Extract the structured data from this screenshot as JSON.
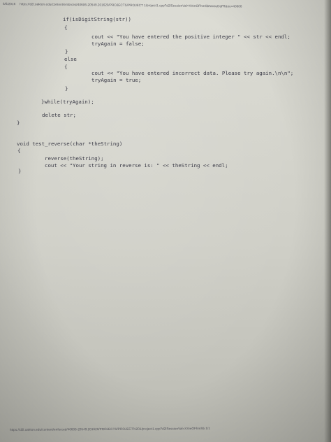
{
  "header": {
    "date": "6/6/2016",
    "url": "https://d2l.oakton.edu/content/enforced/40606-20549.201620/PROJECTS/PROJECT 1/project1.cpp?d2lSessionVal=XXmOFhmSbNwouDqFfl&ou=40606"
  },
  "code_lines": [
    "if(isDigitString(str))",
    "{",
    "cout << \"You have entered the positive integer \" << str << endl;",
    "tryAgain = false;",
    "}",
    "else",
    "{",
    "cout << \"You have entered incorrect data. Please try again.\\n\\n\";",
    "tryAgain = true;",
    "}",
    "}while(tryAgain);",
    "delete str;",
    "}",
    "void test_reverse(char *theString)",
    "{",
    "reverse(theString);",
    "cout << \"Your string in reverse is: \" << theString << endl;",
    "}"
  ],
  "footer": {
    "url": "https://d2l.oakton.edu/content/enforced/40606-20549.201620/PROJECTS/PROJECT%201/project1.cpp?d2lSessionVal=XXmOFhmSb    1/1"
  }
}
